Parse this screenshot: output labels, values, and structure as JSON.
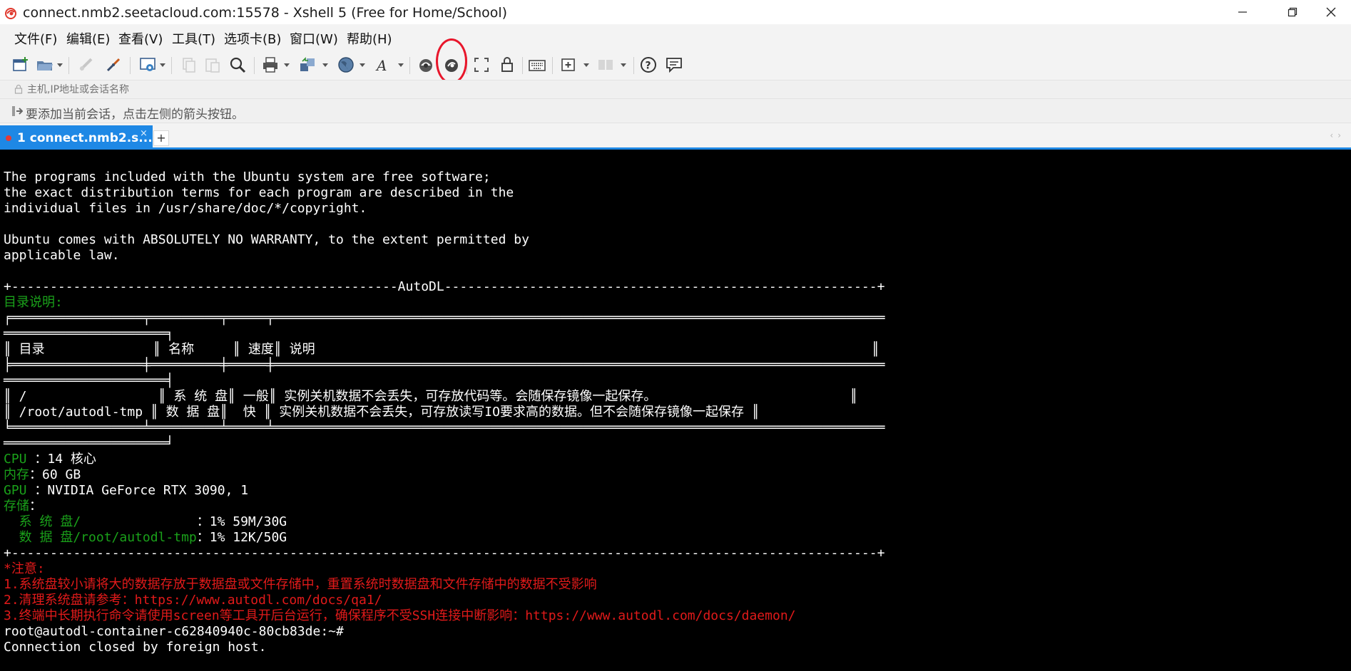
{
  "window": {
    "title": "connect.nmb2.seetacloud.com:15578 - Xshell 5 (Free for Home/School)",
    "controls": [
      "minimize",
      "restore",
      "close"
    ]
  },
  "menu": {
    "items": [
      "文件(F)",
      "编辑(E)",
      "查看(V)",
      "工具(T)",
      "选项卡(B)",
      "窗口(W)",
      "帮助(H)"
    ]
  },
  "toolbar": {
    "icons": [
      "new-session-icon",
      "open-folder-icon",
      "reconnect-icon",
      "disconnect-icon",
      "properties-icon",
      "copy-icon",
      "paste-icon",
      "find-icon",
      "print-icon",
      "transfer-icon",
      "globe-icon",
      "font-icon",
      "xftp-icon",
      "xmanager-icon",
      "fullscreen-icon",
      "lock-icon",
      "keyboard-icon",
      "new-tab-icon",
      "layout-icon",
      "help-icon",
      "chat-icon"
    ],
    "annotation_color": "#e8162b"
  },
  "address_bar": {
    "placeholder": "主机,IP地址或会话名称"
  },
  "links_bar": {
    "text": "要添加当前会话，点击左侧的箭头按钮。"
  },
  "tabs": {
    "active_label": "1 connect.nmb2.s...",
    "close_glyph": "×",
    "add_glyph": "+"
  },
  "colors": {
    "accent": "#1e88e5",
    "terminal_bg": "#000000",
    "terminal_text": "#ffffff",
    "terminal_green": "#1aa11a",
    "terminal_red": "#e11a1a"
  },
  "terminal": {
    "lines": [
      [
        [
          "w",
          "The programs included with the Ubuntu system are free software;"
        ]
      ],
      [
        [
          "w",
          "the exact distribution terms for each program are described in the"
        ]
      ],
      [
        [
          "w",
          "individual files in /usr/share/doc/*/copyright."
        ]
      ],
      [
        [
          "w",
          ""
        ]
      ],
      [
        [
          "w",
          "Ubuntu comes with ABSOLUTELY NO WARRANTY, to the extent permitted by"
        ]
      ],
      [
        [
          "w",
          "applicable law."
        ]
      ],
      [
        [
          "w",
          ""
        ]
      ],
      [
        [
          "w",
          "+--------------------------------------------------AutoDL--------------------------------------------------------+"
        ]
      ],
      [
        [
          "g",
          "目录说明:"
        ]
      ],
      [
        [
          "w",
          "╒═════════════════╤═════════╤═════╤═══════════════════════════════════════════════════════════════════════════════"
        ]
      ],
      [
        [
          "w",
          "═════════════════════╕"
        ]
      ],
      [
        [
          "w",
          "║ 目录              ║ 名称     ║ 速度║ 说明                                                                        ║"
        ]
      ],
      [
        [
          "w",
          "╞═════════════════╪═════════╪═════╪═══════════════════════════════════════════════════════════════════════════════"
        ]
      ],
      [
        [
          "w",
          "═════════════════════╡"
        ]
      ],
      [
        [
          "w",
          "║ /                 ║ 系 统 盘║ 一般║ 实例关机数据不会丢失，可存放代码等。会随保存镜像一起保存。                         ║"
        ]
      ],
      [
        [
          "w",
          "║ /root/autodl-tmp ║ 数 据 盘║  快 ║ 实例关机数据不会丢失，可存放读写IO要求高的数据。但不会随保存镜像一起保存 ║"
        ]
      ],
      [
        [
          "w",
          "╘═════════════════╧═════════╧═════╧═══════════════════════════════════════════════════════════════════════════════"
        ]
      ],
      [
        [
          "w",
          "═════════════════════╛"
        ]
      ],
      [
        [
          "g",
          "CPU"
        ],
        [
          "w",
          " ：14 核心"
        ]
      ],
      [
        [
          "g",
          "内存"
        ],
        [
          "w",
          "：60 GB"
        ]
      ],
      [
        [
          "g",
          "GPU"
        ],
        [
          "w",
          " ：NVIDIA GeForce RTX 3090, 1"
        ]
      ],
      [
        [
          "g",
          "存储"
        ],
        [
          "w",
          "："
        ]
      ],
      [
        [
          "g",
          "  系 统 盘/               "
        ],
        [
          "w",
          "：1% 59M/30G"
        ]
      ],
      [
        [
          "g",
          "  数 据 盘/root/autodl-tmp"
        ],
        [
          "w",
          "：1% 12K/50G"
        ]
      ],
      [
        [
          "w",
          "+----------------------------------------------------------------------------------------------------------------+"
        ]
      ],
      [
        [
          "r",
          "*注意:"
        ]
      ],
      [
        [
          "r",
          "1.系统盘较小请将大的数据存放于数据盘或文件存储中，重置系统时数据盘和文件存储中的数据不受影响"
        ]
      ],
      [
        [
          "r",
          "2.清理系统盘请参考：https://www.autodl.com/docs/qa1/"
        ]
      ],
      [
        [
          "r",
          "3.终端中长期执行命令请使用screen等工具开后台运行，确保程序不受SSH连接中断影响：https://www.autodl.com/docs/daemon/"
        ]
      ],
      [
        [
          "w",
          "root@autodl-container-c62840940c-80cb83de:~#"
        ]
      ],
      [
        [
          "w",
          "Connection closed by foreign host."
        ]
      ]
    ]
  }
}
